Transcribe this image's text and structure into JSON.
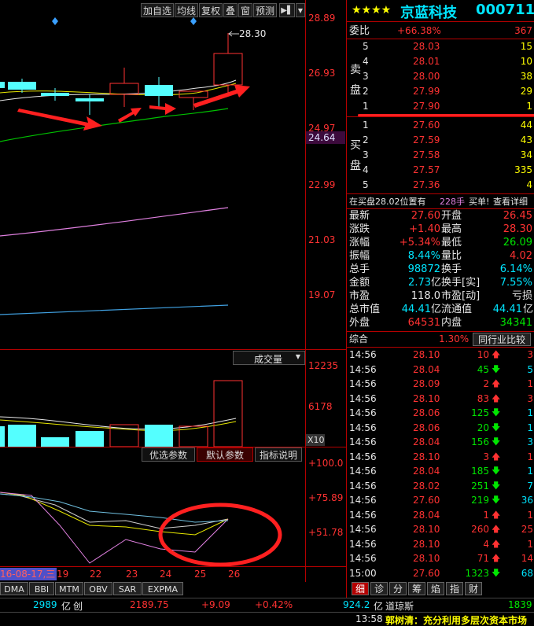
{
  "toolbar": {
    "buttons": [
      "加自选",
      "均线",
      "复权",
      "叠",
      "窗",
      "预测"
    ],
    "more_icon": "play-icon"
  },
  "price_axis": [
    "28.89",
    "26.93",
    "24.97",
    "22.99",
    "21.03",
    "19.07"
  ],
  "last_price_tag": "24.64",
  "high_annotation": "28.30",
  "volume_panel": {
    "selector": "成交量",
    "axis": [
      "12235",
      "6178"
    ],
    "unit": "X10"
  },
  "indicator_panel": {
    "tabs": [
      "优选参数",
      "默认参数",
      "指标说明"
    ],
    "axis": [
      "+100.0",
      "+75.89",
      "+51.78"
    ]
  },
  "date_axis": {
    "current_date": "16-08-17,三",
    "days": [
      "19",
      "22",
      "23",
      "24",
      "25",
      "26"
    ]
  },
  "indicator_tabs": [
    "DMA",
    "BBI",
    "MTM",
    "OBV",
    "SAR",
    "EXPMA"
  ],
  "stock": {
    "stars": "★★★★",
    "name": "京蓝科技",
    "code": "000711"
  },
  "order_ratio": {
    "label": "委比",
    "percent": "+66.38%",
    "diff": "367"
  },
  "sell_label": [
    "卖",
    "盘"
  ],
  "buy_label": [
    "买",
    "盘"
  ],
  "asks": [
    {
      "level": "5",
      "price": "28.03",
      "vol": "15"
    },
    {
      "level": "4",
      "price": "28.01",
      "vol": "10"
    },
    {
      "level": "3",
      "price": "28.00",
      "vol": "38"
    },
    {
      "level": "2",
      "price": "27.99",
      "vol": "29"
    },
    {
      "level": "1",
      "price": "27.90",
      "vol": "1"
    }
  ],
  "bids": [
    {
      "level": "1",
      "price": "27.60",
      "vol": "44"
    },
    {
      "level": "2",
      "price": "27.59",
      "vol": "43"
    },
    {
      "level": "3",
      "price": "27.58",
      "vol": "34"
    },
    {
      "level": "4",
      "price": "27.57",
      "vol": "335"
    },
    {
      "level": "5",
      "price": "27.36",
      "vol": "4"
    }
  ],
  "order_note": {
    "text": "在买盘28.02位置有",
    "lots": "228手",
    "suffix": "买单!",
    "link": "查看详细"
  },
  "stats": [
    {
      "l1": "最新",
      "v1": "27.60",
      "c1": "red",
      "l2": "开盘",
      "v2": "26.45",
      "c2": "red"
    },
    {
      "l1": "涨跌",
      "v1": "+1.40",
      "c1": "red",
      "l2": "最高",
      "v2": "28.30",
      "c2": "red"
    },
    {
      "l1": "涨幅",
      "v1": "+5.34%",
      "c1": "red",
      "l2": "最低",
      "v2": "26.09",
      "c2": "green"
    },
    {
      "l1": "振幅",
      "v1": "8.44%",
      "c1": "cyan",
      "l2": "量比",
      "v2": "4.02",
      "c2": "red"
    },
    {
      "l1": "总手",
      "v1": "98872",
      "c1": "cyan",
      "l2": "换手",
      "v2": "6.14%",
      "c2": "cyan"
    },
    {
      "l1": "金额",
      "v1": "2.73",
      "u1": "亿",
      "c1": "cyan",
      "l2": "换手[实]",
      "v2": "7.55%",
      "c2": "cyan"
    },
    {
      "l1": "市盈",
      "v1": "118.0",
      "c1": "white",
      "l2": "市盈[动]",
      "v2": "亏损",
      "c2": "white"
    },
    {
      "l1": "总市值",
      "v1": "44.41",
      "u1": "亿",
      "c1": "cyan",
      "l2": "流通值",
      "v2": "44.41",
      "u2": "亿",
      "c2": "cyan"
    },
    {
      "l1": "外盘",
      "v1": "64531",
      "c1": "red",
      "l2": "内盘",
      "v2": "34341",
      "c2": "green"
    }
  ],
  "composite": {
    "label": "综合",
    "value": "1.30%",
    "compare": "同行业比较"
  },
  "trades": [
    {
      "time": "14:56",
      "price": "28.10",
      "vol": "10",
      "dir": "up",
      "n": "3"
    },
    {
      "time": "14:56",
      "price": "28.04",
      "vol": "45",
      "dir": "down",
      "n": "5"
    },
    {
      "time": "14:56",
      "price": "28.09",
      "vol": "2",
      "dir": "up",
      "n": "1"
    },
    {
      "time": "14:56",
      "price": "28.10",
      "vol": "83",
      "dir": "up",
      "n": "3"
    },
    {
      "time": "14:56",
      "price": "28.06",
      "vol": "125",
      "dir": "down",
      "n": "1"
    },
    {
      "time": "14:56",
      "price": "28.06",
      "vol": "20",
      "dir": "down",
      "n": "1"
    },
    {
      "time": "14:56",
      "price": "28.04",
      "vol": "156",
      "dir": "down",
      "n": "3"
    },
    {
      "time": "14:56",
      "price": "28.10",
      "vol": "3",
      "dir": "up",
      "n": "1"
    },
    {
      "time": "14:56",
      "price": "28.04",
      "vol": "185",
      "dir": "down",
      "n": "1"
    },
    {
      "time": "14:56",
      "price": "28.02",
      "vol": "251",
      "dir": "down",
      "n": "7"
    },
    {
      "time": "14:56",
      "price": "27.60",
      "vol": "219",
      "dir": "down",
      "n": "36"
    },
    {
      "time": "14:56",
      "price": "28.04",
      "vol": "1",
      "dir": "up",
      "n": "1"
    },
    {
      "time": "14:56",
      "price": "28.10",
      "vol": "260",
      "dir": "up",
      "n": "25"
    },
    {
      "time": "14:56",
      "price": "28.10",
      "vol": "4",
      "dir": "up",
      "n": "1"
    },
    {
      "time": "14:56",
      "price": "28.10",
      "vol": "71",
      "dir": "up",
      "n": "14"
    },
    {
      "time": "15:00",
      "price": "27.60",
      "vol": "1323",
      "dir": "down",
      "n": "68"
    }
  ],
  "quote_tabs": [
    "细",
    "诊",
    "分",
    "筹",
    "焰",
    "指",
    "财"
  ],
  "status_bar": {
    "amount1": "2989",
    "unit1": "亿",
    "name1": "创",
    "index_value": "2189.75",
    "change": "+9.09",
    "change_pct": "+0.42%",
    "amount2": "924.2",
    "unit2": "亿",
    "name2": "道琼斯",
    "value2": "1839"
  },
  "news": {
    "time": "13:58",
    "text": "郭树清：充分利用多层次资本市场"
  },
  "colors": {
    "up": "#ff3232",
    "down": "#00e600",
    "accent": "#00e5ff",
    "frame": "#b40000"
  }
}
